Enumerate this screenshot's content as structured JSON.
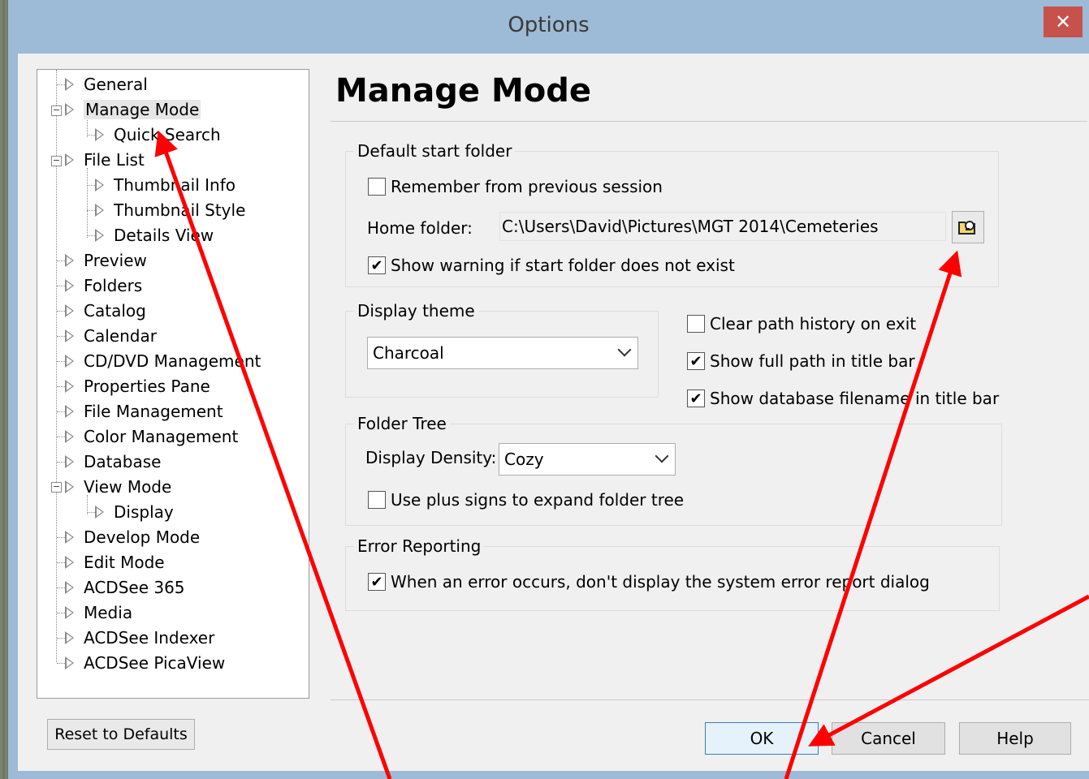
{
  "window": {
    "title": "Options",
    "close_glyph": "✕"
  },
  "tree": {
    "items": [
      {
        "label": "General"
      },
      {
        "label": "Manage Mode"
      },
      {
        "label": "Quick Search"
      },
      {
        "label": "File List"
      },
      {
        "label": "Thumbnail Info"
      },
      {
        "label": "Thumbnail Style"
      },
      {
        "label": "Details View"
      },
      {
        "label": "Preview"
      },
      {
        "label": "Folders"
      },
      {
        "label": "Catalog"
      },
      {
        "label": "Calendar"
      },
      {
        "label": "CD/DVD Management"
      },
      {
        "label": "Properties Pane"
      },
      {
        "label": "File Management"
      },
      {
        "label": "Color Management"
      },
      {
        "label": "Database"
      },
      {
        "label": "View Mode"
      },
      {
        "label": "Display"
      },
      {
        "label": "Develop Mode"
      },
      {
        "label": "Edit Mode"
      },
      {
        "label": "ACDSee 365"
      },
      {
        "label": "Media"
      },
      {
        "label": "ACDSee Indexer"
      },
      {
        "label": "ACDSee PicaView"
      }
    ],
    "selected": "Manage Mode",
    "expander_glyph": "−"
  },
  "reset_label": "Reset to Defaults",
  "page": {
    "heading": "Manage Mode",
    "start_folder": {
      "legend": "Default start folder",
      "remember_label": "Remember from previous session",
      "remember_checked": false,
      "home_label": "Home folder:",
      "home_value": "C:\\Users\\David\\Pictures\\MGT 2014\\Cemeteries",
      "warning_label": "Show warning if start folder does not exist",
      "warning_checked": true
    },
    "theme": {
      "legend": "Display theme",
      "value": "Charcoal"
    },
    "options": {
      "clear_history_label": "Clear path history on exit",
      "clear_history_checked": false,
      "full_path_label": "Show full path in title bar",
      "full_path_checked": true,
      "db_filename_label": "Show database filename in title bar",
      "db_filename_checked": true
    },
    "folder_tree": {
      "legend": "Folder Tree",
      "density_label": "Display Density:",
      "density_value": "Cozy",
      "plus_signs_label": "Use plus signs to expand folder tree",
      "plus_signs_checked": false
    },
    "error_reporting": {
      "legend": "Error Reporting",
      "suppress_label": "When an error occurs, don't display the system error report dialog",
      "suppress_checked": true
    },
    "check_glyph": "✔"
  },
  "buttons": {
    "ok": "OK",
    "cancel": "Cancel",
    "help": "Help"
  },
  "colors": {
    "title_bar": "#9dbad6",
    "close_button": "#c7514d",
    "annotation_arrow": "#ff0000"
  },
  "icons": {
    "browse": "folder-browse-icon",
    "close": "close-icon"
  }
}
